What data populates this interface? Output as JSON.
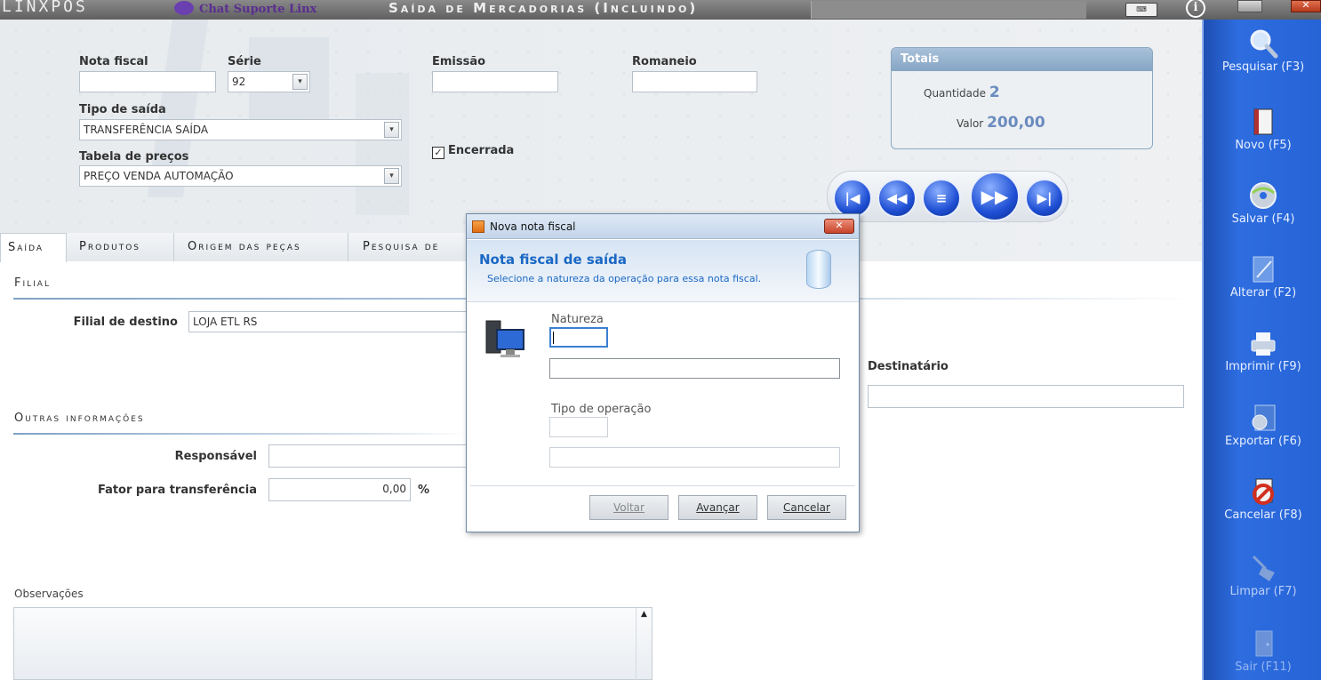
{
  "titlebar": {
    "logo": "LINXPOS",
    "chat_label": "Chat Suporte Linx",
    "window_title": "Saída de Mercadorias (Incluindo)"
  },
  "form": {
    "nota_fiscal_label": "Nota fiscal",
    "nota_fiscal_value": "",
    "serie_label": "Série",
    "serie_value": "92",
    "emissao_label": "Emissão",
    "emissao_value": "",
    "romaneio_label": "Romaneio",
    "romaneio_value": "",
    "tipo_saida_label": "Tipo de saída",
    "tipo_saida_value": "TRANSFERÊNCIA SAÍDA",
    "tabela_precos_label": "Tabela de preços",
    "tabela_precos_value": "PREÇO VENDA AUTOMAÇÃO",
    "encerrada_label": "Encerrada",
    "encerrada_checked": true
  },
  "totais": {
    "title": "Totais",
    "quantidade_label": "Quantidade",
    "quantidade_value": "2",
    "valor_label": "Valor",
    "valor_value": "200,00"
  },
  "tabs": [
    {
      "label": "Saída",
      "active": true
    },
    {
      "label": "Produtos",
      "active": false
    },
    {
      "label": "Origem das peças",
      "active": false
    },
    {
      "label": "Pesquisa de",
      "active": false
    }
  ],
  "filial": {
    "section_title": "Filial",
    "destino_label": "Filial de destino",
    "destino_value": "LOJA ETL RS",
    "destinatario_label": "Destinatário",
    "destinatario_value": ""
  },
  "outras": {
    "section_title": "Outras informações",
    "responsavel_label": "Responsável",
    "responsavel_value": "",
    "fator_label": "Fator para transferência",
    "fator_value": "0,00",
    "fator_unit": "%"
  },
  "observacoes": {
    "label": "Observações",
    "value": ""
  },
  "sidebar": {
    "items": [
      {
        "label": "Pesquisar (F3)",
        "icon": "magnifier-icon"
      },
      {
        "label": "Novo (F5)",
        "icon": "new-document-icon"
      },
      {
        "label": "Salvar (F4)",
        "icon": "disc-save-icon"
      },
      {
        "label": "Alterar (F2)",
        "icon": "edit-icon"
      },
      {
        "label": "Imprimir (F9)",
        "icon": "printer-icon"
      },
      {
        "label": "Exportar (F6)",
        "icon": "export-icon"
      },
      {
        "label": "Cancelar (F8)",
        "icon": "cancel-icon"
      },
      {
        "label": "Limpar (F7)",
        "icon": "broom-icon"
      },
      {
        "label": "Sair (F11)",
        "icon": "exit-door-icon"
      }
    ]
  },
  "dialog": {
    "title": "Nova nota fiscal",
    "heading": "Nota fiscal de saída",
    "subheading": "Selecione a natureza da operação para essa nota fiscal.",
    "natureza_label": "Natureza",
    "natureza_code": "",
    "natureza_desc": "",
    "tipo_operacao_label": "Tipo de operação",
    "tipo_operacao_code": "",
    "tipo_operacao_desc": "",
    "voltar_label": "Voltar",
    "avancar_label": "Avançar",
    "cancelar_label": "Cancelar"
  },
  "colors": {
    "sidebar_blue": "#2563d6",
    "dialog_heading_blue": "#1a68c4",
    "section_line": "#7fa2c6"
  }
}
